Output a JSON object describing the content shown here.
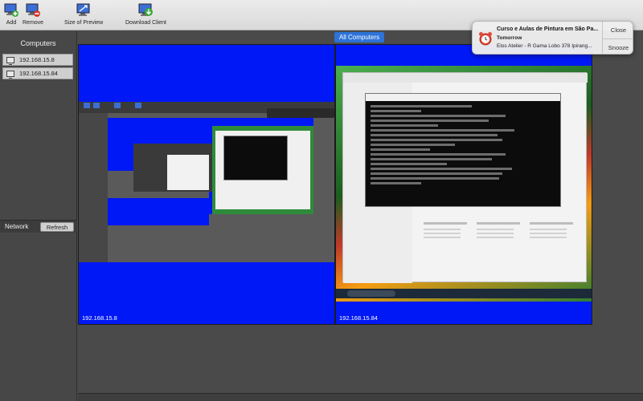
{
  "toolbar": {
    "add_label": "Add",
    "remove_label": "Remove",
    "size_label": "Size of Preview",
    "download_label": "Download Client"
  },
  "sidebar": {
    "header": "Computers",
    "items": [
      {
        "label": "192.168.15.8"
      },
      {
        "label": "192.168.15.84"
      }
    ],
    "network_label": "Network",
    "refresh_label": "Refresh"
  },
  "main": {
    "tab_label": "All Computers",
    "panels": [
      {
        "ip": "192.168.15.8"
      },
      {
        "ip": "192.168.15.84"
      }
    ]
  },
  "notification": {
    "title": "Curso e Aulas de Pintura em São Pa...",
    "subtitle": "Tomorrow",
    "body": "Elos Atelier - R Gama Lobo 378 Ipirang...",
    "close_label": "Close",
    "snooze_label": "Snooze"
  },
  "colors": {
    "accent": "#2d73d8",
    "preview_blue": "#0018f5",
    "background": "#4a4a4a"
  }
}
